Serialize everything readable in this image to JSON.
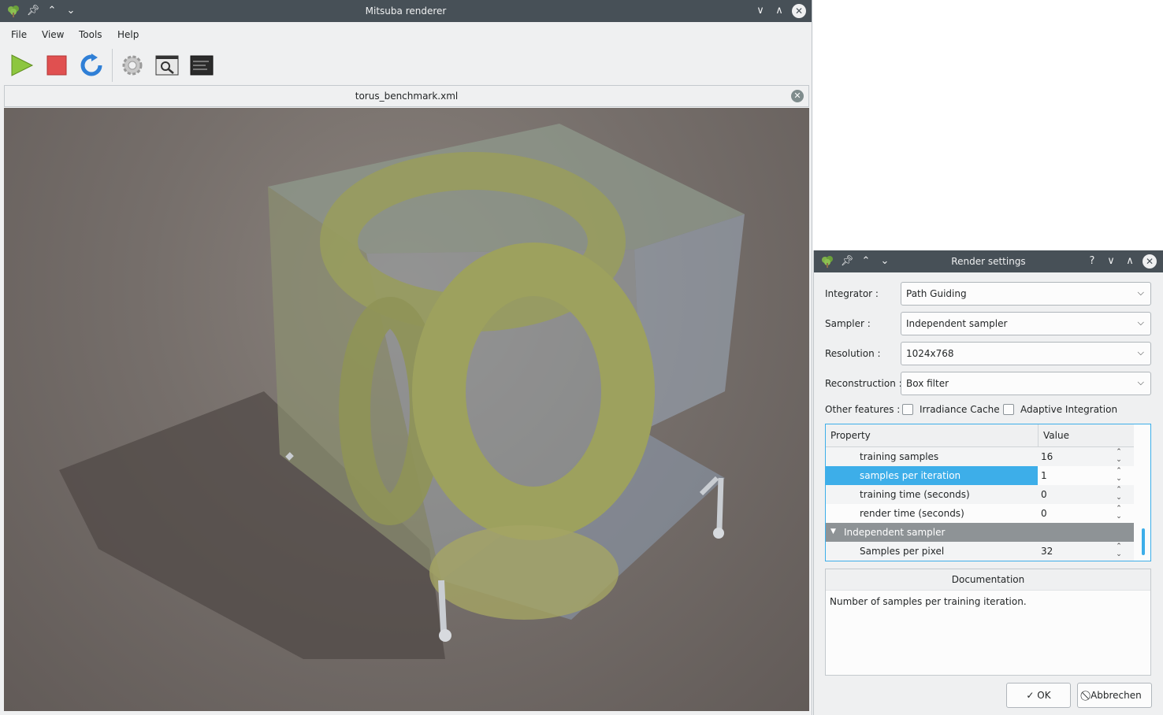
{
  "main": {
    "title": "Mitsuba renderer",
    "menu": [
      "File",
      "View",
      "Tools",
      "Help"
    ],
    "toolbar": {
      "icons": [
        "play-icon",
        "stop-icon",
        "refresh-icon",
        "settings-icon",
        "preview-icon",
        "console-icon"
      ]
    },
    "tab": {
      "label": "torus_benchmark.xml"
    }
  },
  "dialog": {
    "title": "Render settings",
    "help": "?",
    "fields": {
      "integrator": {
        "label": "Integrator :",
        "value": "Path Guiding"
      },
      "sampler": {
        "label": "Sampler :",
        "value": "Independent sampler"
      },
      "resolution": {
        "label": "Resolution :",
        "value": "1024x768"
      },
      "reconstruction": {
        "label": "Reconstruction :",
        "value": "Box filter"
      }
    },
    "features": {
      "label": "Other features :",
      "irradiance": "Irradiance Cache",
      "adaptive": "Adaptive Integration"
    },
    "table": {
      "headers": [
        "Property",
        "Value"
      ],
      "rows": [
        {
          "name": "training samples",
          "value": "16"
        },
        {
          "name": "samples per iteration",
          "value": "1"
        },
        {
          "name": "training time (seconds)",
          "value": "0"
        },
        {
          "name": "render time (seconds)",
          "value": "0"
        },
        {
          "name": "Independent sampler",
          "value": ""
        },
        {
          "name": "Samples per pixel",
          "value": "32"
        }
      ]
    },
    "documentation": {
      "title": "Documentation",
      "text": "Number of samples per training iteration."
    },
    "buttons": {
      "ok": "OK",
      "cancel": "Abbrechen"
    }
  }
}
